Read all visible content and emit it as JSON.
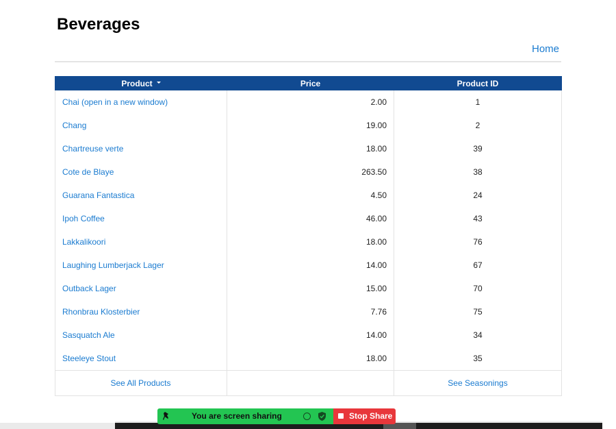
{
  "page": {
    "title": "Beverages",
    "home_link": "Home"
  },
  "table": {
    "headers": {
      "product": "Product",
      "price": "Price",
      "product_id": "Product ID"
    },
    "sort_indicator": "chevron-down-icon",
    "rows": [
      {
        "name": "Chai  (open in a new window)",
        "price": "2.00",
        "id": "1"
      },
      {
        "name": "Chang",
        "price": "19.00",
        "id": "2"
      },
      {
        "name": "Chartreuse verte",
        "price": "18.00",
        "id": "39"
      },
      {
        "name": "Cote de Blaye",
        "price": "263.50",
        "id": "38"
      },
      {
        "name": "Guarana Fantastica",
        "price": "4.50",
        "id": "24"
      },
      {
        "name": "Ipoh Coffee",
        "price": "46.00",
        "id": "43"
      },
      {
        "name": "Lakkalikoori",
        "price": "18.00",
        "id": "76"
      },
      {
        "name": "Laughing Lumberjack Lager",
        "price": "14.00",
        "id": "67"
      },
      {
        "name": "Outback Lager",
        "price": "15.00",
        "id": "70"
      },
      {
        "name": "Rhonbrau Klosterbier",
        "price": "7.76",
        "id": "75"
      },
      {
        "name": "Sasquatch Ale",
        "price": "14.00",
        "id": "34"
      },
      {
        "name": "Steeleye Stout",
        "price": "18.00",
        "id": "35"
      }
    ],
    "footer": {
      "left_link": "See All Products",
      "middle": "",
      "right_link": "See Seasonings"
    }
  },
  "screen_share": {
    "status_text": "You are screen sharing",
    "stop_label": "Stop Share",
    "icons": [
      "pin-icon",
      "circle-icon",
      "shield-check-icon",
      "stop-icon"
    ]
  },
  "colors": {
    "header_bg": "#114a91",
    "link": "#1a7bd0",
    "share_green": "#23c552",
    "stop_red": "#e8373b"
  }
}
